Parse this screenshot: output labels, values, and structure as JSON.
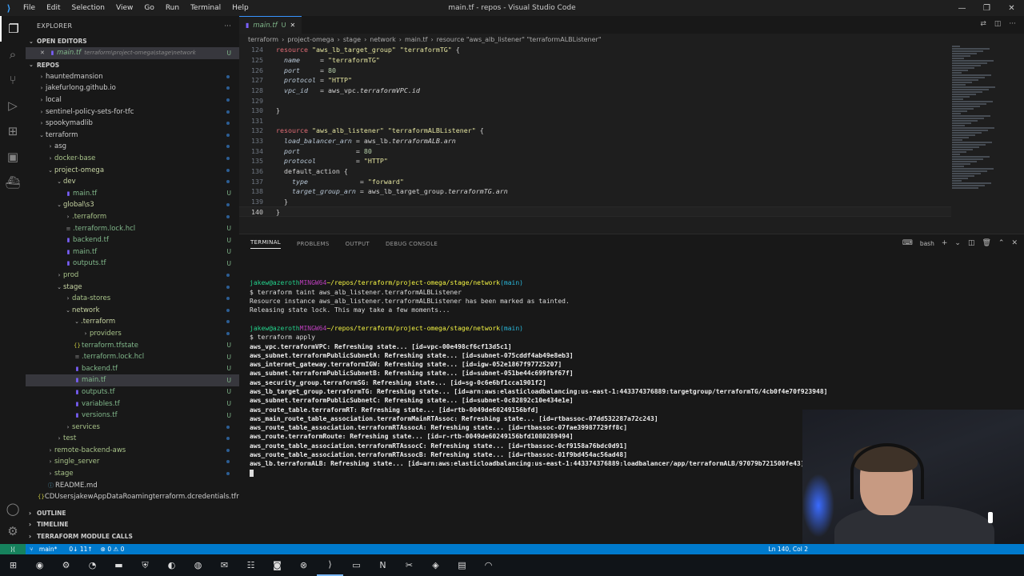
{
  "window": {
    "title": "main.tf - repos - Visual Studio Code",
    "menu": [
      "File",
      "Edit",
      "Selection",
      "View",
      "Go",
      "Run",
      "Terminal",
      "Help"
    ]
  },
  "sidebar": {
    "header": "EXPLORER",
    "open_editors_label": "OPEN EDITORS",
    "open_editor": {
      "name": "main.tf",
      "path": "terraform\\project-omega\\stage\\network",
      "badge": "U"
    },
    "repos_label": "REPOS",
    "tree": [
      {
        "name": "hauntedmansion",
        "indent": 1,
        "type": "folder",
        "open": false
      },
      {
        "name": "jakefurlong.github.io",
        "indent": 1,
        "type": "folder",
        "open": false
      },
      {
        "name": "local",
        "indent": 1,
        "type": "folder",
        "open": false
      },
      {
        "name": "sentinel-policy-sets-for-tfc",
        "indent": 1,
        "type": "folder",
        "open": false
      },
      {
        "name": "spookymadlib",
        "indent": 1,
        "type": "folder",
        "open": false
      },
      {
        "name": "terraform",
        "indent": 1,
        "type": "folder",
        "open": true
      },
      {
        "name": "asg",
        "indent": 2,
        "type": "folder",
        "open": false
      },
      {
        "name": "docker-base",
        "indent": 2,
        "type": "folder",
        "open": false
      },
      {
        "name": "project-omega",
        "indent": 2,
        "type": "folder",
        "open": true
      },
      {
        "name": "dev",
        "indent": 3,
        "type": "folder",
        "open": true
      },
      {
        "name": "main.tf",
        "indent": 4,
        "type": "file",
        "badge": "U"
      },
      {
        "name": "global\\s3",
        "indent": 3,
        "type": "folder",
        "open": true
      },
      {
        "name": ".terraform",
        "indent": 4,
        "type": "folder",
        "open": false
      },
      {
        "name": ".terraform.lock.hcl",
        "indent": 4,
        "type": "file",
        "badge": "U"
      },
      {
        "name": "backend.tf",
        "indent": 4,
        "type": "file",
        "badge": "U"
      },
      {
        "name": "main.tf",
        "indent": 4,
        "type": "file",
        "badge": "U"
      },
      {
        "name": "outputs.tf",
        "indent": 4,
        "type": "file",
        "badge": "U"
      },
      {
        "name": "prod",
        "indent": 3,
        "type": "folder",
        "open": false
      },
      {
        "name": "stage",
        "indent": 3,
        "type": "folder",
        "open": true
      },
      {
        "name": "data-stores",
        "indent": 4,
        "type": "folder",
        "open": false
      },
      {
        "name": "network",
        "indent": 4,
        "type": "folder",
        "open": true
      },
      {
        "name": ".terraform",
        "indent": 5,
        "type": "folder",
        "open": true
      },
      {
        "name": "providers",
        "indent": 6,
        "type": "folder",
        "open": false
      },
      {
        "name": "terraform.tfstate",
        "indent": 5,
        "type": "json",
        "badge": "U"
      },
      {
        "name": ".terraform.lock.hcl",
        "indent": 5,
        "type": "file",
        "badge": "U"
      },
      {
        "name": "backend.tf",
        "indent": 5,
        "type": "file",
        "badge": "U"
      },
      {
        "name": "main.tf",
        "indent": 5,
        "type": "file",
        "badge": "U",
        "selected": true
      },
      {
        "name": "outputs.tf",
        "indent": 5,
        "type": "file",
        "badge": "U"
      },
      {
        "name": "variables.tf",
        "indent": 5,
        "type": "file",
        "badge": "U"
      },
      {
        "name": "versions.tf",
        "indent": 5,
        "type": "file",
        "badge": "U"
      },
      {
        "name": "services",
        "indent": 4,
        "type": "folder",
        "open": false
      },
      {
        "name": "test",
        "indent": 3,
        "type": "folder",
        "open": false
      },
      {
        "name": "remote-backend-aws",
        "indent": 2,
        "type": "folder",
        "open": false
      },
      {
        "name": "single_server",
        "indent": 2,
        "type": "folder",
        "open": false
      },
      {
        "name": "stage",
        "indent": 2,
        "type": "folder",
        "open": false
      },
      {
        "name": "README.md",
        "indent": 2,
        "type": "md"
      },
      {
        "name": "CDUsersjakewAppDataRoamingterraform.dcredentials.tfrc.json",
        "indent": 1,
        "type": "json"
      }
    ],
    "bottom_sections": [
      "OUTLINE",
      "TIMELINE",
      "TERRAFORM MODULE CALLS"
    ]
  },
  "editor": {
    "tab": {
      "name": "main.tf",
      "badge": "U"
    },
    "breadcrumb": [
      "terraform",
      "project-omega",
      "stage",
      "network",
      "main.tf",
      "resource \"aws_alb_listener\" \"terraformALBListener\""
    ],
    "lines": [
      {
        "n": "124",
        "tokens": [
          [
            "kw",
            "resource "
          ],
          [
            "str",
            "\"aws_lb_target_group\" \"terraformTG\""
          ],
          [
            "p",
            " {"
          ]
        ]
      },
      {
        "n": "125",
        "tokens": [
          [
            "p",
            "  "
          ],
          [
            "attr",
            "name"
          ],
          [
            "p",
            "     = "
          ],
          [
            "str",
            "\"terraformTG\""
          ]
        ]
      },
      {
        "n": "126",
        "tokens": [
          [
            "p",
            "  "
          ],
          [
            "attr",
            "port"
          ],
          [
            "p",
            "     = "
          ],
          [
            "num",
            "80"
          ]
        ]
      },
      {
        "n": "127",
        "tokens": [
          [
            "p",
            "  "
          ],
          [
            "attr",
            "protocol"
          ],
          [
            "p",
            " = "
          ],
          [
            "str",
            "\"HTTP\""
          ]
        ]
      },
      {
        "n": "128",
        "tokens": [
          [
            "p",
            "  "
          ],
          [
            "attr",
            "vpc_id"
          ],
          [
            "p",
            "   = aws_vpc."
          ],
          [
            "id",
            "terraformVPC.id"
          ]
        ]
      },
      {
        "n": "129",
        "tokens": []
      },
      {
        "n": "130",
        "tokens": [
          [
            "p",
            "}"
          ]
        ]
      },
      {
        "n": "131",
        "tokens": []
      },
      {
        "n": "132",
        "tokens": [
          [
            "kw",
            "resource "
          ],
          [
            "str",
            "\"aws_alb_listener\" \"terraformALBListener\""
          ],
          [
            "p",
            " {"
          ]
        ]
      },
      {
        "n": "133",
        "tokens": [
          [
            "p",
            "  "
          ],
          [
            "attr",
            "load_balancer_arn"
          ],
          [
            "p",
            " = aws_lb."
          ],
          [
            "id",
            "terraformALB.arn"
          ]
        ]
      },
      {
        "n": "134",
        "tokens": [
          [
            "p",
            "  "
          ],
          [
            "attr",
            "port"
          ],
          [
            "p",
            "              = "
          ],
          [
            "num",
            "80"
          ]
        ]
      },
      {
        "n": "135",
        "tokens": [
          [
            "p",
            "  "
          ],
          [
            "attr",
            "protocol"
          ],
          [
            "p",
            "          = "
          ],
          [
            "str",
            "\"HTTP\""
          ]
        ]
      },
      {
        "n": "136",
        "tokens": [
          [
            "p",
            "  default_action {"
          ]
        ]
      },
      {
        "n": "137",
        "tokens": [
          [
            "p",
            "    "
          ],
          [
            "attr",
            "type"
          ],
          [
            "p",
            "             = "
          ],
          [
            "str",
            "\"forward\""
          ]
        ]
      },
      {
        "n": "138",
        "tokens": [
          [
            "p",
            "    "
          ],
          [
            "attr",
            "target_group_arn"
          ],
          [
            "p",
            " = aws_lb_target_group."
          ],
          [
            "id",
            "terraformTG.arn"
          ]
        ]
      },
      {
        "n": "139",
        "tokens": [
          [
            "p",
            "  }"
          ]
        ]
      },
      {
        "n": "140",
        "tokens": [
          [
            "p",
            "}"
          ]
        ],
        "current": true
      }
    ]
  },
  "panel": {
    "tabs": [
      "TERMINAL",
      "PROBLEMS",
      "OUTPUT",
      "DEBUG CONSOLE"
    ],
    "shell": "bash",
    "terminal": [
      {
        "type": "blank"
      },
      {
        "type": "prompt",
        "user": "jakew@azeroth",
        "env": "MINGW64",
        "path": "~/repos/terraform/project-omega/stage/network",
        "branch": "(main)"
      },
      {
        "type": "text",
        "text": "$ terraform taint aws_alb_listener.terraformALBListener"
      },
      {
        "type": "text",
        "text": "Resource instance aws_alb_listener.terraformALBListener has been marked as tainted."
      },
      {
        "type": "text",
        "text": "Releasing state lock. This may take a few moments..."
      },
      {
        "type": "blank"
      },
      {
        "type": "prompt",
        "user": "jakew@azeroth",
        "env": "MINGW64",
        "path": "~/repos/terraform/project-omega/stage/network",
        "branch": "(main)"
      },
      {
        "type": "text",
        "text": "$ terraform apply"
      },
      {
        "type": "bold",
        "text": "aws_vpc.terraformVPC: Refreshing state... [id=vpc-00e498cf6cf13d5c1]"
      },
      {
        "type": "bold",
        "text": "aws_subnet.terraformPublicSubnetA: Refreshing state... [id=subnet-075cddf4ab49e8eb3]"
      },
      {
        "type": "bold",
        "text": "aws_internet_gateway.terraformIGW: Refreshing state... [id=igw-052e1867f97725207]"
      },
      {
        "type": "bold",
        "text": "aws_subnet.terraformPublicSubnetB: Refreshing state... [id=subnet-051be44c699fbf67f]"
      },
      {
        "type": "bold",
        "text": "aws_security_group.terraformSG: Refreshing state... [id=sg-0c6e6bf1cca1901f2]"
      },
      {
        "type": "bold",
        "text": "aws_lb_target_group.terraformTG: Refreshing state... [id=arn:aws:elasticloadbalancing:us-east-1:443374376889:targetgroup/terraformTG/4cb0f4e70f923948]"
      },
      {
        "type": "bold",
        "text": "aws_subnet.terraformPublicSubnetC: Refreshing state... [id=subnet-0c82892c10e434e1e]"
      },
      {
        "type": "bold",
        "text": "aws_route_table.terraformRT: Refreshing state... [id=rtb-0049de60249156bfd]"
      },
      {
        "type": "bold",
        "text": "aws_main_route_table_association.terraformMainRTAssoc: Refreshing state... [id=rtbassoc-07dd532287a72c243]"
      },
      {
        "type": "bold",
        "text": "aws_route_table_association.terraformRTAssocA: Refreshing state... [id=rtbassoc-07fae39987729ff8c]"
      },
      {
        "type": "bold",
        "text": "aws_route.terraformRoute: Refreshing state... [id=r-rtb-0049de60249156bfd1080289494]"
      },
      {
        "type": "bold",
        "text": "aws_route_table_association.terraformRTAssocC: Refreshing state... [id=rtbassoc-0cf9158a76bdc0d91]"
      },
      {
        "type": "bold",
        "text": "aws_route_table_association.terraformRTAssocB: Refreshing state... [id=rtbassoc-01f9bd454ac56ad48]"
      },
      {
        "type": "bold",
        "text": "aws_lb.terraformALB: Refreshing state... [id=arn:aws:elasticloadbalancing:us-east-1:443374376889:loadbalancer/app/terraformALB/97079b721500fe43]"
      },
      {
        "type": "cursor"
      }
    ]
  },
  "statusbar": {
    "branch": "main*",
    "sync": "0↓ 11↑",
    "problems": "⊗ 0 ⚠ 0",
    "position": "Ln 140, Col 2"
  },
  "colors": {
    "accent": "#007acc",
    "remote": "#16825d",
    "untracked": "#81b88b",
    "modified": "#e2c08d"
  }
}
